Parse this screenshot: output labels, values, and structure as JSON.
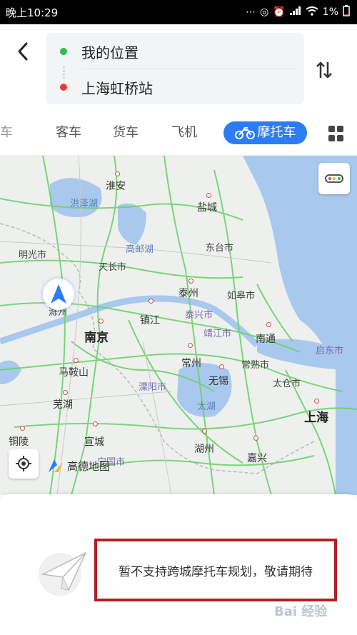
{
  "status_bar": {
    "time": "晚上10:29",
    "battery": "1%",
    "icons": [
      "more-dots-icon",
      "hotspot-icon",
      "alarm-icon",
      "signal-icon",
      "wifi-icon",
      "battery-icon"
    ]
  },
  "route": {
    "from": "我的位置",
    "to": "上海虹桥站",
    "icons": {
      "back": "back-arrow-icon",
      "swap": "swap-icon"
    },
    "colors": {
      "from_dot": "#2dbb4d",
      "to_dot": "#ee3a36"
    }
  },
  "tabs": {
    "items": [
      {
        "label": "车",
        "state": "partial"
      },
      {
        "label": "客车"
      },
      {
        "label": "货车"
      },
      {
        "label": "飞机"
      },
      {
        "label": "摩托车",
        "selected": true,
        "icon": "motorcycle-icon"
      }
    ],
    "more_icon": "grid-icon",
    "accent": "#2c7cf6"
  },
  "map": {
    "cities_major": [
      "南京",
      "上海"
    ],
    "cities": [
      "淮安",
      "盐城",
      "明光市",
      "东台市",
      "天长市",
      "泰州",
      "如皋市",
      "镇江",
      "泰兴市",
      "靖江市",
      "南通",
      "启东市",
      "马鞍山",
      "常州",
      "常熟市",
      "溧阳市",
      "无锡",
      "太仓市",
      "芜湖",
      "铜陵",
      "宣城",
      "湖州",
      "嘉兴",
      "宁国市",
      "滁州"
    ],
    "lakes": [
      "洪泽湖",
      "高邮湖",
      "太湖"
    ],
    "brand": "高德地图",
    "colors": {
      "water": "#a9c8ee",
      "road": "#6cd36a",
      "land": "#eef0ee"
    }
  },
  "notice": {
    "message": "暂不支持跨城摩托车规划，敬请期待",
    "highlight_color": "#b21f1f"
  },
  "watermark": "Bai 经验"
}
